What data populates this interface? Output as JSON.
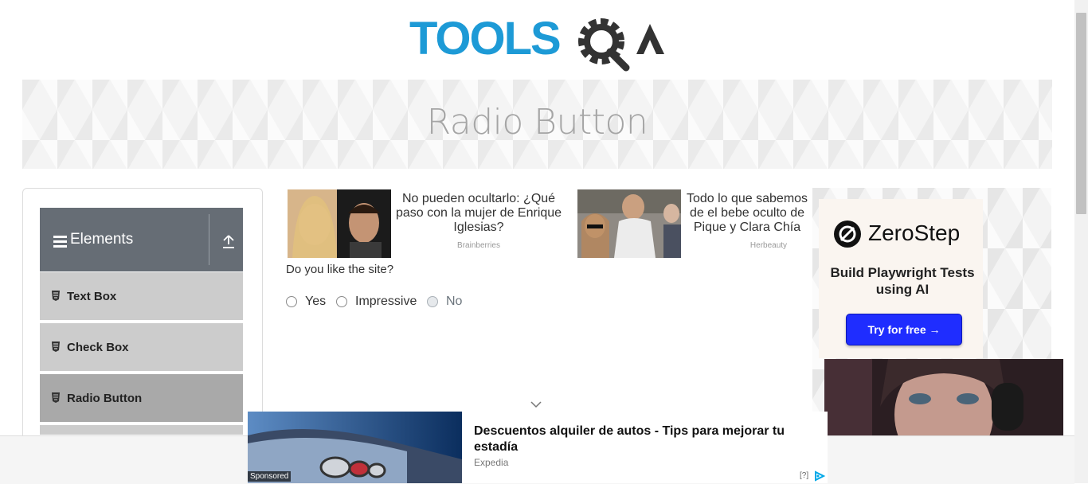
{
  "logo": {
    "text_part": "TOOLS",
    "q_part": "Q",
    "a_part": "A",
    "blue": "#1d9ad6",
    "dark": "#333333"
  },
  "banner": {
    "title": "Radio Button"
  },
  "sidebar": {
    "group_label": "Elements",
    "items": [
      {
        "label": "Text Box",
        "active": false
      },
      {
        "label": "Check Box",
        "active": false
      },
      {
        "label": "Radio Button",
        "active": true
      }
    ]
  },
  "ads": [
    {
      "text": "No pueden ocultarlo: ¿Qué paso con la mujer de Enrique Iglesias?",
      "source": "Brainberries"
    },
    {
      "text": "Todo lo que sabemos de el bebe oculto de Pique y Clara Chía",
      "source": "Herbeauty"
    }
  ],
  "form": {
    "question": "Do you like the site?",
    "options": [
      {
        "label": "Yes",
        "disabled": false
      },
      {
        "label": "Impressive",
        "disabled": false
      },
      {
        "label": "No",
        "disabled": true
      }
    ]
  },
  "side_ad": {
    "brand": "ZeroStep",
    "tagline": "Build Playwright Tests using AI",
    "cta": "Try for free →",
    "cta_color": "#1f2dff"
  },
  "bottom_ad": {
    "title": "Descuentos alquiler de autos - Tips para mejorar tu estadía",
    "source": "Expedia",
    "sponsored": "Sponsored",
    "adchoice": "[?]"
  }
}
